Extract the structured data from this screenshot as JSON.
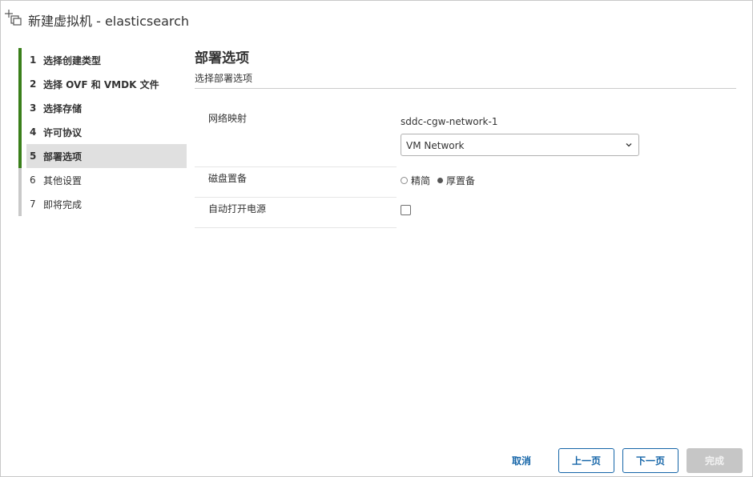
{
  "window": {
    "title": "新建虚拟机 - elasticsearch",
    "icon": "new-vm-icon"
  },
  "steps": [
    {
      "num": "1",
      "label": "选择创建类型",
      "state": "done"
    },
    {
      "num": "2",
      "label": "选择 OVF 和 VMDK 文件",
      "state": "done"
    },
    {
      "num": "3",
      "label": "选择存储",
      "state": "done"
    },
    {
      "num": "4",
      "label": "许可协议",
      "state": "done"
    },
    {
      "num": "5",
      "label": "部署选项",
      "state": "current"
    },
    {
      "num": "6",
      "label": "其他设置",
      "state": "pending"
    },
    {
      "num": "7",
      "label": "即将完成",
      "state": "pending"
    }
  ],
  "main": {
    "title": "部署选项",
    "subtitle": "选择部署选项",
    "network_mapping": {
      "label": "网络映射",
      "source_network": "sddc-cgw-network-1",
      "selected_network": "VM Network"
    },
    "disk_provisioning": {
      "label": "磁盘置备",
      "options": [
        {
          "label": "精简",
          "selected": false
        },
        {
          "label": "厚置备",
          "selected": true
        }
      ]
    },
    "auto_power_on": {
      "label": "自动打开电源",
      "checked": false
    }
  },
  "footer": {
    "cancel": "取消",
    "back": "上一页",
    "next": "下一页",
    "finish": "完成"
  },
  "colors": {
    "step_done_bar": "#3a7f1a",
    "step_pending_bar": "#c9c9c9",
    "primary_blue": "#1565a8",
    "disabled_button": "#c6c6c6"
  }
}
